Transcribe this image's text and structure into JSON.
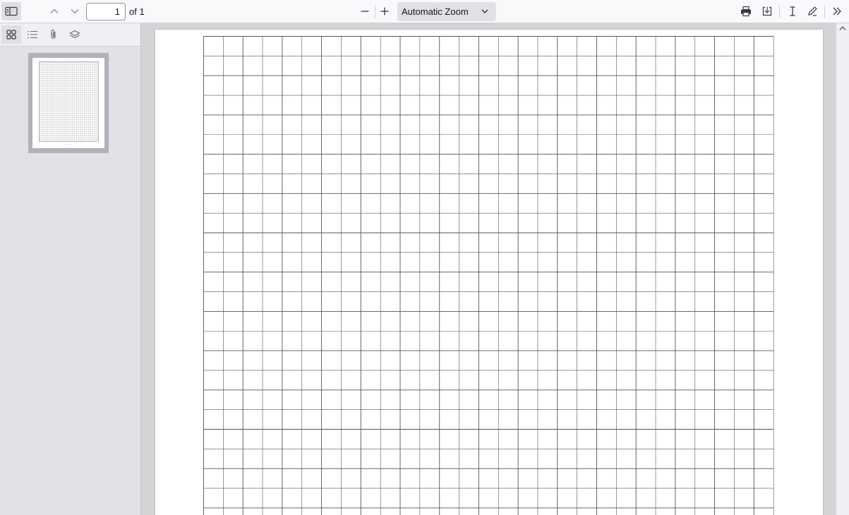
{
  "toolbar": {
    "page_number": "1",
    "page_count_label": "of 1",
    "zoom_value": "Automatic Zoom"
  },
  "icons": {
    "sidebar_toggle": "sidebar-toggle-icon",
    "previous_page": "chevron-up-icon",
    "next_page": "chevron-down-icon",
    "zoom_out": "minus-icon",
    "zoom_in": "plus-icon",
    "zoom_dropdown": "chevron-down-icon",
    "print": "printer-icon",
    "save": "download-icon",
    "text_tool": "text-cursor-icon",
    "draw_tool": "pencil-icon",
    "tools_menu": "double-chevron-right-icon",
    "thumbnails": "grid-icon",
    "outline": "list-icon",
    "attachments": "paperclip-icon",
    "layers": "layers-icon",
    "scroll_up": "chevron-up-icon"
  },
  "document": {
    "grid_columns": 29,
    "grid_rows_visible": 24,
    "line_color": "#555555"
  },
  "colors": {
    "toolbar_bg": "#f9f9fb",
    "sidebar_bg": "#e1e1e6",
    "viewer_bg": "#d4d4d7",
    "active_button_bg": "#dfdfe3"
  }
}
